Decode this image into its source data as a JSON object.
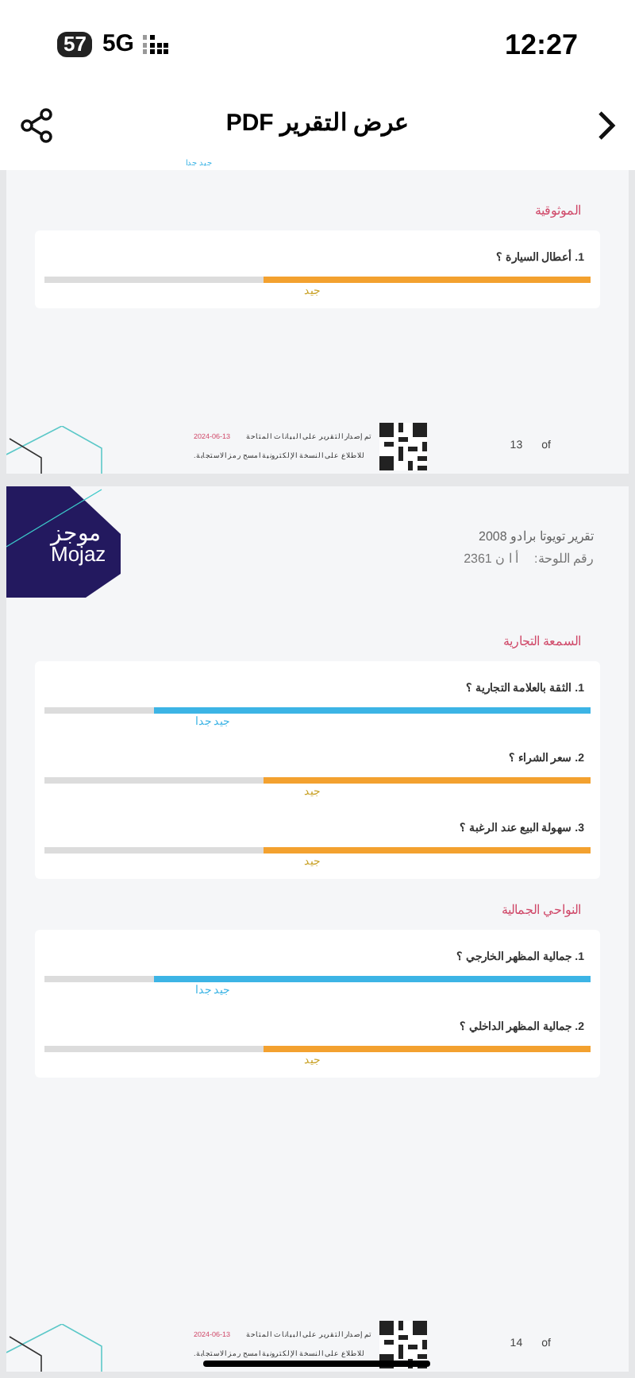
{
  "status_bar": {
    "time": "12:27",
    "battery": "57",
    "network": "5G"
  },
  "header": {
    "title": "عرض التقرير PDF"
  },
  "pages": [
    {
      "kind": "continued",
      "cut_rating": "جيد جدا",
      "sections": [
        {
          "title": "الموثوقية",
          "questions": [
            {
              "label": "1. أعطال السيارة ؟",
              "level": 0.6,
              "rating": "جيد",
              "kind": "good"
            }
          ]
        }
      ],
      "footer": {
        "issued": "تم إصدار التقرير على البيانات المتاحة",
        "date": "2024-06-13",
        "scan": "للاطلاع على النسخة الإلكترونية امسح رمز الاستجابة.",
        "page": "13",
        "of": "of"
      }
    },
    {
      "kind": "first",
      "logo": {
        "arabic": "موجز",
        "latin": "Mojaz"
      },
      "report_title": "تقرير تويوتا برادو 2008",
      "plate_label": "رقم اللوحة:",
      "plate_value": "أ ا ن 2361",
      "sections": [
        {
          "title": "السمعة التجارية",
          "questions": [
            {
              "label": "1. الثقة بالعلامة التجارية ؟",
              "level": 0.8,
              "rating": "جيد جدا",
              "kind": "very_good"
            },
            {
              "label": "2. سعر الشراء ؟",
              "level": 0.6,
              "rating": "جيد",
              "kind": "good"
            },
            {
              "label": "3. سهولة البيع عند الرغبة ؟",
              "level": 0.6,
              "rating": "جيد",
              "kind": "good"
            }
          ]
        },
        {
          "title": "النواحي الجمالية",
          "questions": [
            {
              "label": "1. جمالية المظهر الخارجي ؟",
              "level": 0.8,
              "rating": "جيد جدا",
              "kind": "very_good"
            },
            {
              "label": "2. جمالية المظهر الداخلي ؟",
              "level": 0.6,
              "rating": "جيد",
              "kind": "good"
            }
          ]
        }
      ],
      "footer": {
        "issued": "تم إصدار التقرير على البيانات المتاحة",
        "date": "2024-06-13",
        "scan": "للاطلاع على النسخة الإلكترونية امسح رمز الاستجابة.",
        "page": "14",
        "of": "of"
      }
    }
  ]
}
